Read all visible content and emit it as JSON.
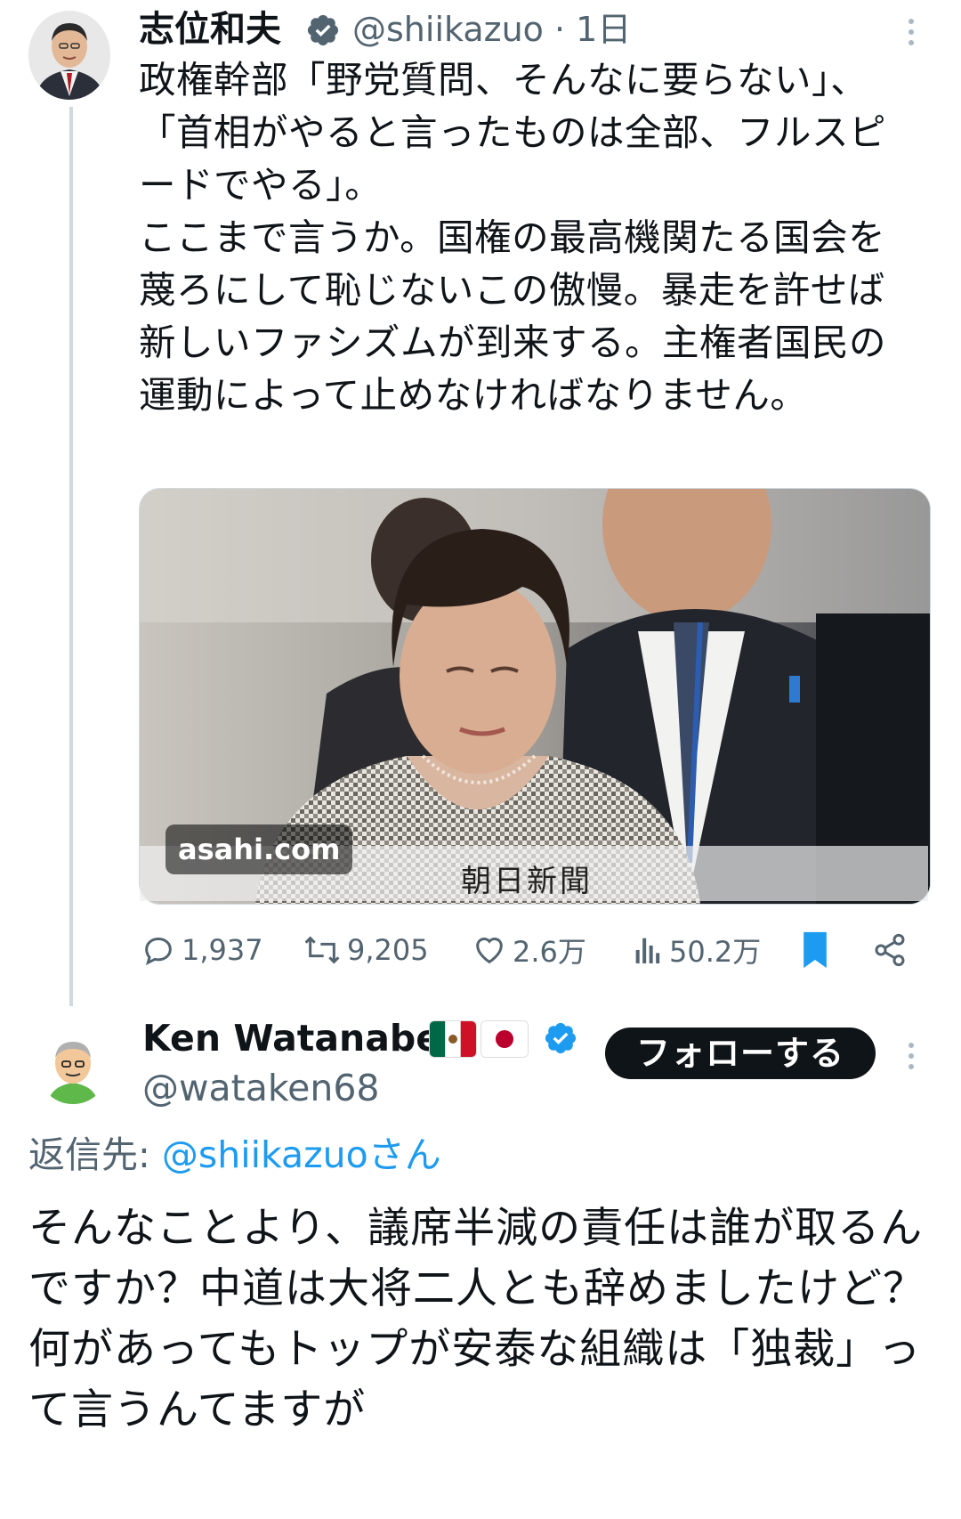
{
  "tweet": {
    "author_name": "志位和夫",
    "author_handle": "@shiikazuo · 1日",
    "text": "政権幹部「野党質問、そんなに要らない」、「首相がやると言ったものは全部、フルスピードでやる」。\nここまで言うか。国権の最高機関たる国会を蔑ろにして恥じないこの傲慢。暴走を許せば新しいファシズムが到来する。主権者国民の運動によって止めなければなりません。",
    "media": {
      "domain": "asahi.com",
      "caption": "朝日新聞"
    },
    "actions": {
      "replies": "1,937",
      "reposts": "9,205",
      "likes": "2.6万",
      "views": "50.2万"
    }
  },
  "reply": {
    "author_name": "Ken Watanabe",
    "author_handle": "@wataken68",
    "follow_label": "フォローする",
    "reply_to_prefix": "返信先: ",
    "reply_to_mention": "@shiikazuoさん",
    "text": "そんなことより、議席半減の責任は誰が取るんですか？中道は大将二人とも辞めましたけど？\n何があってもトップが安泰な組織は「独裁」って言うんてますが"
  },
  "colors": {
    "verified": "#1d9bf0",
    "bookmark": "#1d9bf0",
    "muted": "#536471",
    "text": "#0f1419",
    "follow_button": "#0f1419"
  },
  "icons": [
    "verified-badge-icon",
    "more-icon",
    "reply-icon",
    "repost-icon",
    "like-icon",
    "views-icon",
    "bookmark-icon",
    "share-icon",
    "mexico-flag-icon",
    "japan-flag-icon"
  ]
}
